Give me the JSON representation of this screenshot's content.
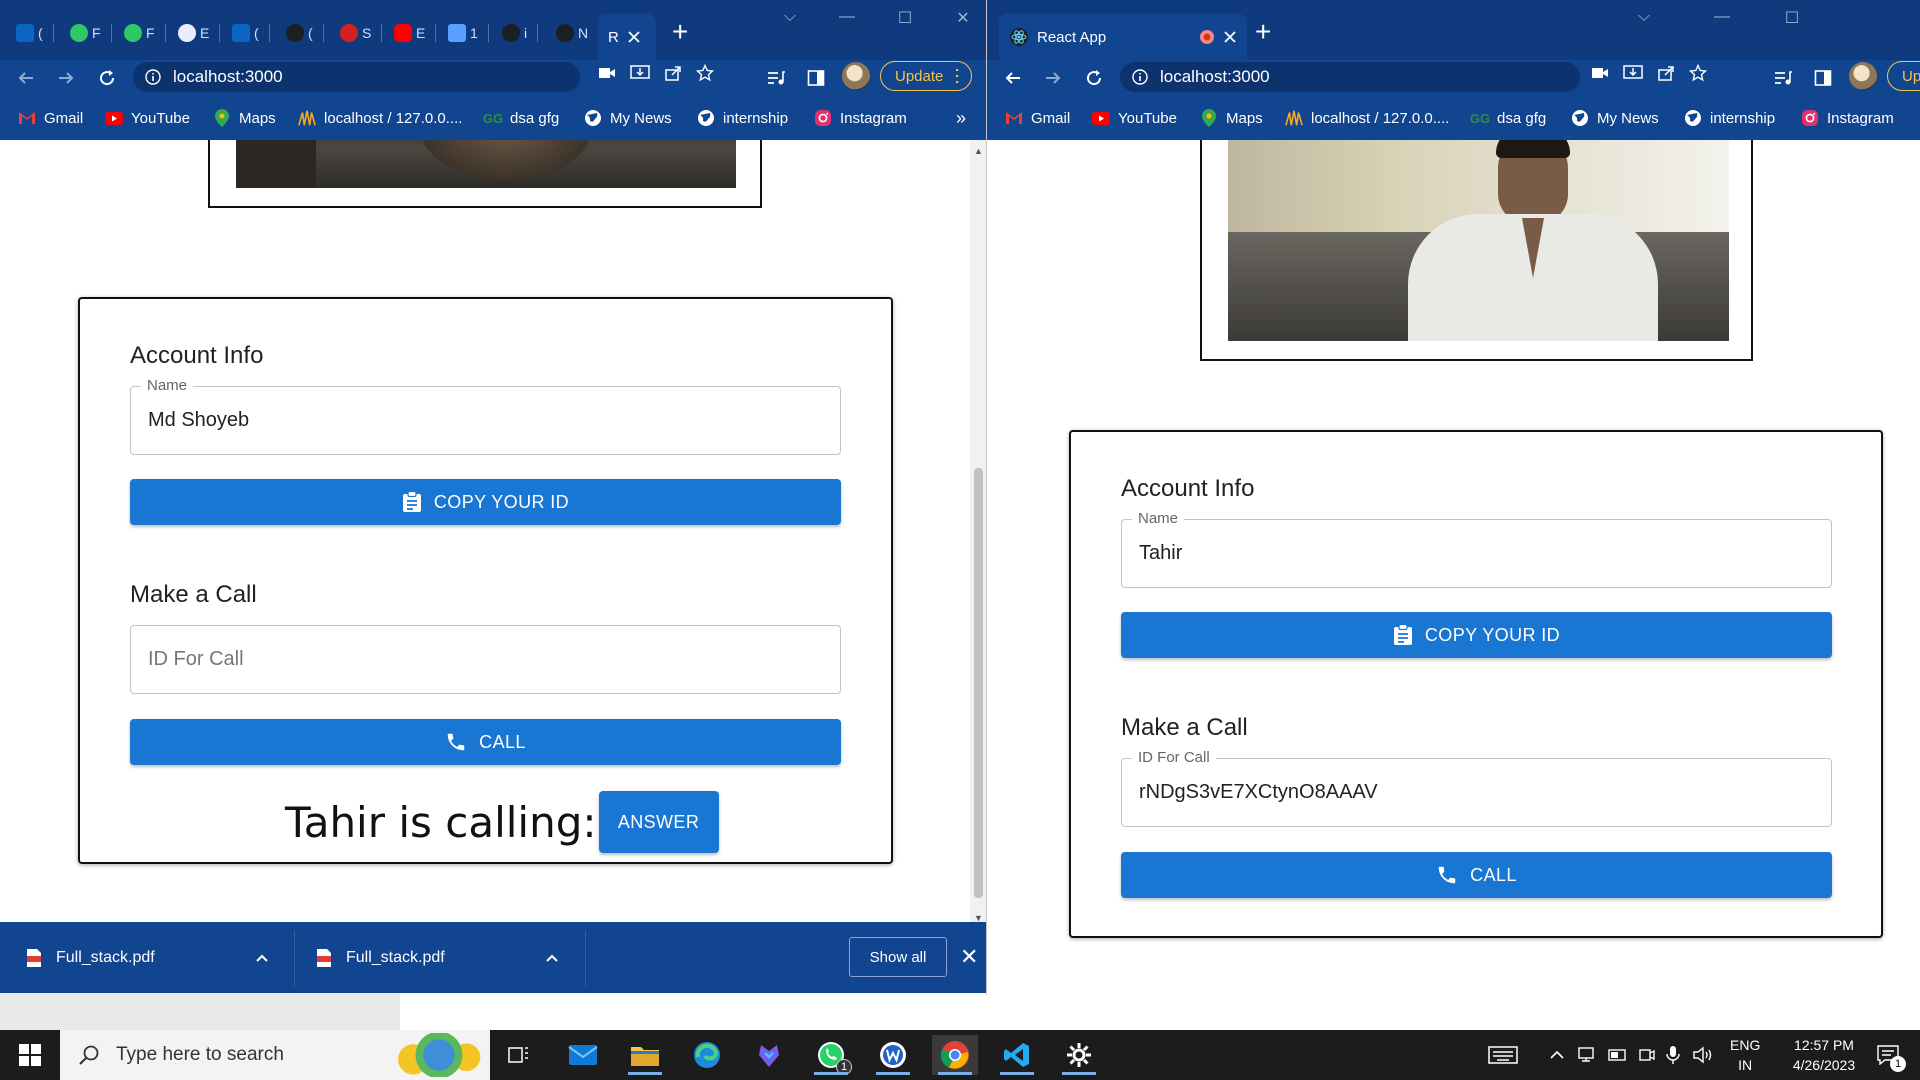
{
  "left_window": {
    "active_tab": {
      "label": "R"
    },
    "address": {
      "url": "localhost:3000"
    },
    "update_label": "Update",
    "account": {
      "title": "Account Info",
      "name_label": "Name",
      "name_value": "Md Shoyeb",
      "copy_label": "COPY YOUR ID"
    },
    "call": {
      "title": "Make a Call",
      "id_placeholder": "ID For Call",
      "call_label": "CALL"
    },
    "incoming": {
      "text": "Tahir is calling:",
      "answer_label": "ANSWER"
    },
    "downloads": {
      "file1": "Full_stack.pdf",
      "file2": "Full_stack.pdf",
      "show_all": "Show all"
    }
  },
  "right_window": {
    "active_tab": {
      "label": "React App"
    },
    "address": {
      "url": "localhost:3000"
    },
    "update_label": "Upd",
    "account": {
      "title": "Account Info",
      "name_label": "Name",
      "name_value": "Tahir",
      "copy_label": "COPY YOUR ID"
    },
    "call": {
      "title": "Make a Call",
      "id_label": "ID For Call",
      "id_value": "rNDgS3vE7XCtynO8AAAV",
      "call_label": "CALL"
    }
  },
  "bookmarks": [
    "Gmail",
    "YouTube",
    "Maps",
    "localhost / 127.0.0....",
    "dsa gfg",
    "My News",
    "internship",
    "Instagram"
  ],
  "bookmarks_overflow": "»",
  "mini_tabs": [
    "(",
    "F",
    "F",
    "E",
    "(",
    "(",
    "S",
    "E",
    "1",
    "i",
    "N"
  ],
  "taskbar": {
    "search_placeholder": "Type here to search",
    "language": "ENG",
    "region": "IN",
    "time": "12:57 PM",
    "date": "4/26/2023",
    "whatsapp_badge": "1",
    "notification_badge": "1"
  },
  "colors": {
    "browser_frame": "#0f3a7d",
    "toolbar": "#114590",
    "primary_button": "#1976d2",
    "update_outline": "#f6c44d",
    "taskbar": "#1c1c1c"
  }
}
